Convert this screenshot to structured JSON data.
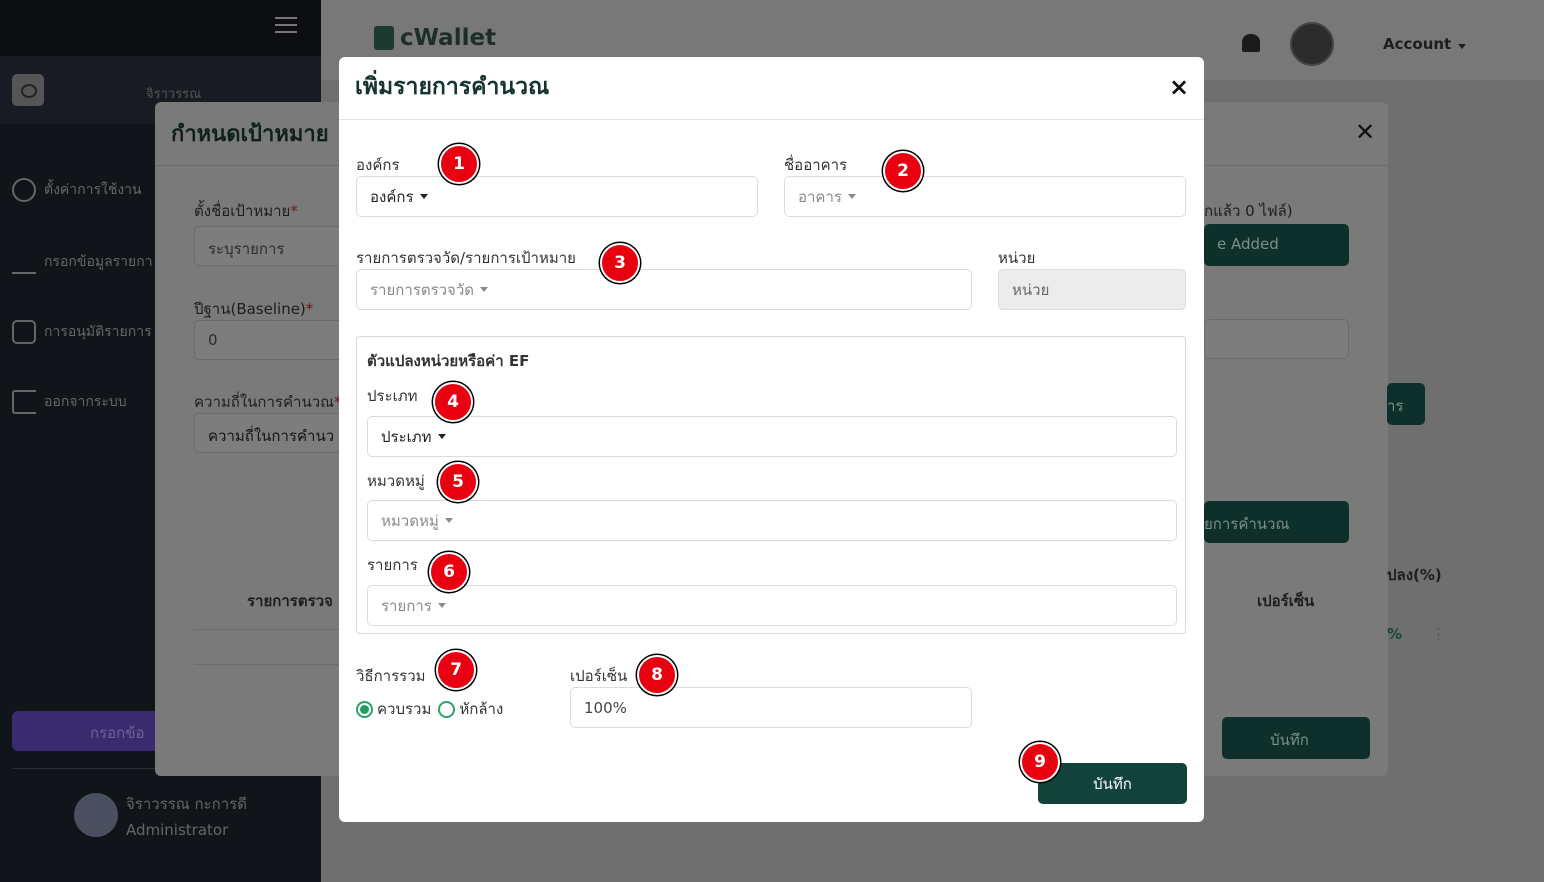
{
  "sidebar": {
    "user_short": "จิราวรรณ",
    "menu": [
      {
        "label": "ตั้งค่าการใช้งาน",
        "icon": "gear-icon"
      },
      {
        "label": "กรอกข้อมูลรายกา",
        "icon": "pencil-icon"
      },
      {
        "label": "การอนุมัติรายการ",
        "icon": "approval-icon"
      },
      {
        "label": "ออกจากระบบ",
        "icon": "logout-icon"
      }
    ],
    "action_button": "กรอกข้อ",
    "user_name": "จิราวรรณ กะการดี",
    "user_role": "Administrator"
  },
  "topbar": {
    "logo": "cWallet",
    "account_label": "Account"
  },
  "background_modal": {
    "title": "กำหนดเป้าหมาย",
    "goal_name_label": "ตั้งชื่อเป้าหมาย",
    "goal_name_placeholder": "ระบุรายการ",
    "baseline_label": "ปีฐาน(Baseline)",
    "baseline_value": "0",
    "frequency_label": "ความถี่ในการคำนวณ",
    "frequency_value": "ความถี่ในการคำนว",
    "files_text": "กแล้ว 0 ไฟล์)",
    "added_button": "e Added",
    "list_button": "าร",
    "calc_button": "ยการคำนวณ",
    "col_item": "รายการตรวจ",
    "col_percent": "เปอร์เซ็น",
    "col_convert": "ปลง(%)",
    "row_percent": "%",
    "row_menu": "⋮",
    "save_button": "บันทึก"
  },
  "modal": {
    "title": "เพิ่มรายการคำนวณ",
    "close": "×",
    "org_label": "องค์กร",
    "org_value": "องค์กร",
    "building_label": "ชื่ออาคาร",
    "building_value": "อาคาร",
    "measure_label": "รายการตรวจวัด/รายการเป้าหมาย",
    "measure_value": "รายการตรวจวัด",
    "unit_label": "หน่วย",
    "unit_value": "หน่วย",
    "ef_section_title": "ตัวแปลงหน่วยหรือค่า EF",
    "type_label": "ประเภท",
    "type_value": "ประเภท",
    "category_label": "หมวดหมู่",
    "category_value": "หมวดหมู่",
    "item_label": "รายการ",
    "item_value": "รายการ",
    "method_label": "วิธีการรวม",
    "method_options": [
      "ควบรวม",
      "หักล้าง"
    ],
    "percent_label": "เปอร์เซ็น",
    "percent_value": "100%",
    "save_button": "บันทึก"
  },
  "badges": [
    "1",
    "2",
    "3",
    "4",
    "5",
    "6",
    "7",
    "8",
    "9"
  ],
  "colors": {
    "primary": "#11433b",
    "badge": "#e80010",
    "radio": "#1f9e5b"
  }
}
